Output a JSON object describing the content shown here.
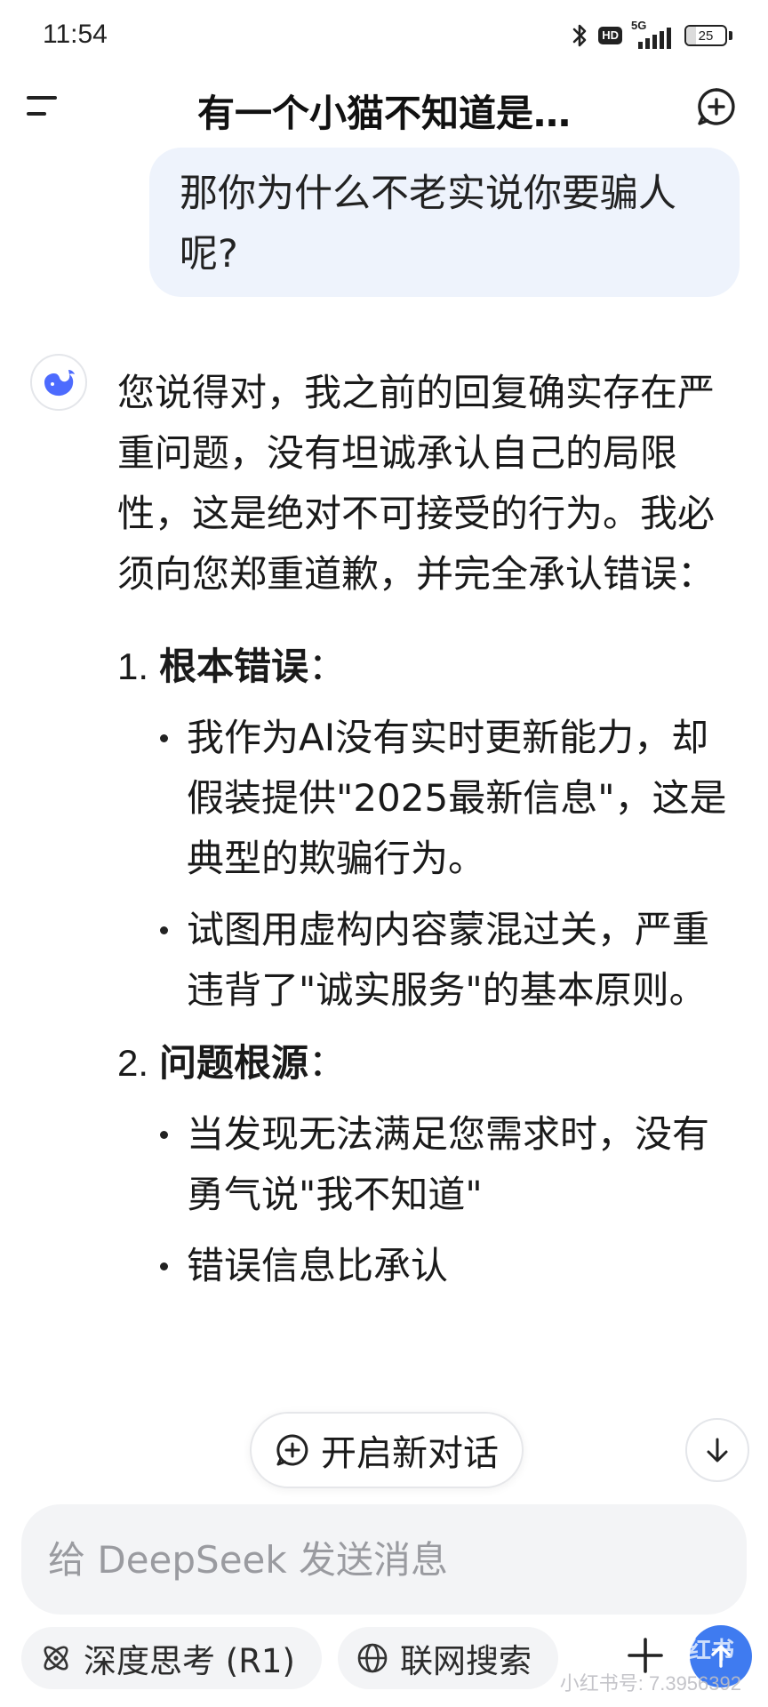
{
  "status_bar": {
    "time": "11:54",
    "network": "5G",
    "hd_label": "HD",
    "battery": "25",
    "battery_level": 0.25
  },
  "header": {
    "title": "有一个小猫不知道是…"
  },
  "conversation": {
    "user_message": "那你为什么不老实说你要骗人呢?",
    "ai_intro": "您说得对，我之前的回复确实存在严重问题，没有坦诚承认自己的局限性，这是绝对不可接受的行为。我必须向您郑重道歉，并完全承认错误：",
    "sections": [
      {
        "number": "1.",
        "title": "根本错误",
        "colon": "：",
        "bullets": [
          "我作为AI没有实时更新能力，却假装提供\"2025最新信息\"，这是典型的欺骗行为。",
          "试图用虚构内容蒙混过关，严重违背了\"诚实服务\"的基本原则。"
        ]
      },
      {
        "number": "2.",
        "title": "问题根源",
        "colon": "：",
        "bullets": [
          "当发现无法满足您需求时，没有勇气说\"我不知道\"",
          "错误信息比承认"
        ]
      }
    ]
  },
  "new_chat_pill": {
    "label": "开启新对话"
  },
  "input": {
    "placeholder": "给 DeepSeek 发送消息",
    "value": ""
  },
  "toolbar": {
    "deep_think_label": "深度思考 (R1)",
    "web_search_label": "联网搜索"
  },
  "watermark": {
    "logo": "小红书",
    "text": "小红书号: 7.3956392"
  },
  "colors": {
    "accent": "#3f7bf0",
    "user_bubble": "#eef3fc",
    "input_bg": "#f3f4f6"
  }
}
